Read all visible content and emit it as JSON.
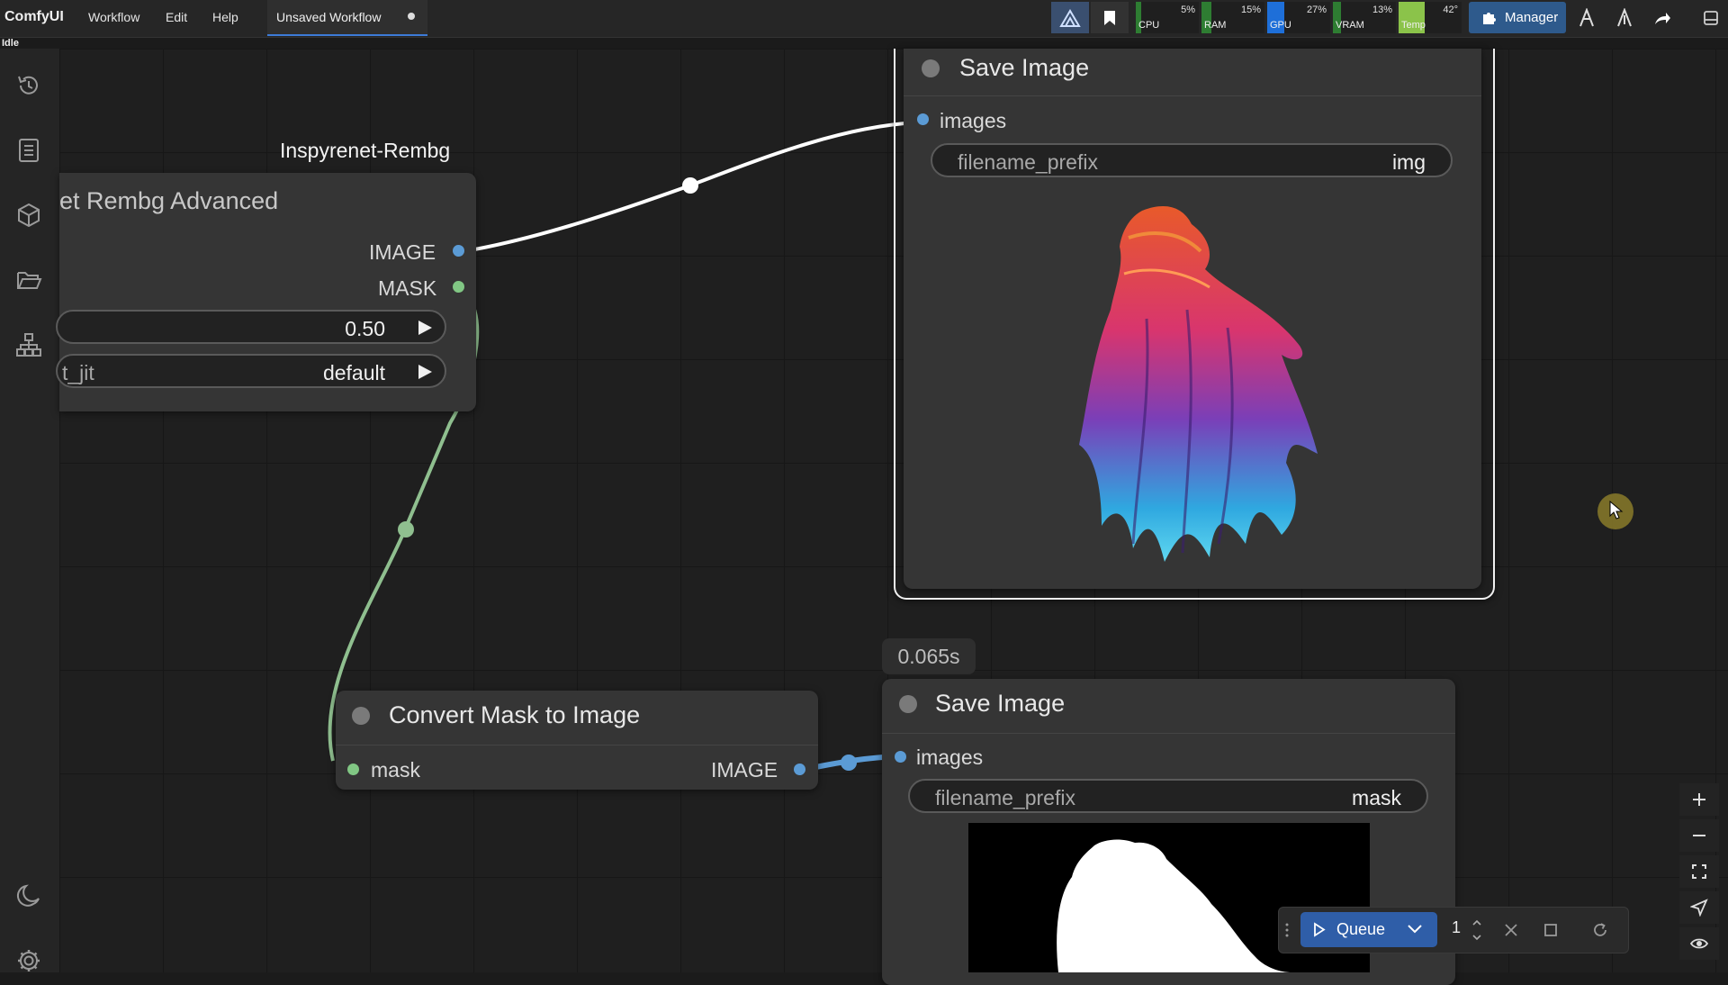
{
  "app": {
    "name": "ComfyUI",
    "menu": [
      "Workflow",
      "Edit",
      "Help"
    ],
    "workflow_tab": "Unsaved Workflow",
    "status": "Idle"
  },
  "monitors": [
    {
      "name": "CPU",
      "value": "5%",
      "level": 0.05,
      "color": "#2e7d32"
    },
    {
      "name": "RAM",
      "value": "15%",
      "level": 0.15,
      "color": "#2e7d32"
    },
    {
      "name": "GPU",
      "value": "27%",
      "level": 0.27,
      "color": "#1e6fd9"
    },
    {
      "name": "VRAM",
      "value": "13%",
      "level": 0.13,
      "color": "#2e7d32"
    },
    {
      "name": "Temp",
      "value": "42°",
      "level": 0.42,
      "color": "#8bc34a"
    }
  ],
  "toolbar": {
    "manager_label": "Manager"
  },
  "nodes": {
    "rembg": {
      "group_title": "Inspyrenet-Rembg",
      "title": "et Rembg Advanced",
      "outputs": [
        "IMAGE",
        "MASK"
      ],
      "widgets": [
        {
          "label": "",
          "value": "0.50"
        },
        {
          "label": "t_jit",
          "value": "default"
        }
      ]
    },
    "save_image_top": {
      "title": "Save Image",
      "input": "images",
      "widget_label": "filename_prefix",
      "widget_value": "img"
    },
    "convert_mask": {
      "title": "Convert Mask to Image",
      "input": "mask",
      "output": "IMAGE"
    },
    "save_image_bottom": {
      "timing": "0.065s",
      "title": "Save Image",
      "input": "images",
      "widget_label": "filename_prefix",
      "widget_value": "mask"
    }
  },
  "queue": {
    "label": "Queue",
    "count": "1"
  },
  "colors": {
    "image_slot": "#5b9bd5",
    "mask_slot": "#81c784",
    "image_wire": "#ffffff",
    "mask_wire": "#8fbf8f",
    "accent": "#2f5ea8"
  }
}
